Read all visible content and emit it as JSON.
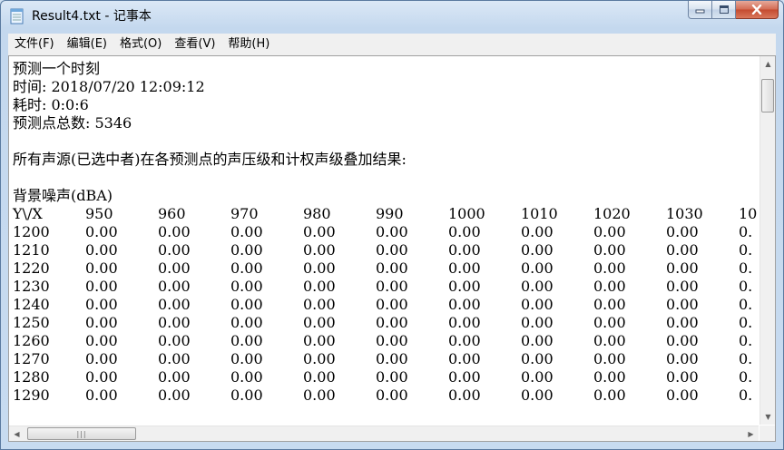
{
  "window": {
    "title": "Result4.txt - 记事本",
    "controls": {
      "minimize": "minimize",
      "maximize": "maximize",
      "close": "close"
    }
  },
  "menu": [
    {
      "label": "文件(F)"
    },
    {
      "label": "编辑(E)"
    },
    {
      "label": "格式(O)"
    },
    {
      "label": "查看(V)"
    },
    {
      "label": "帮助(H)"
    }
  ],
  "document": {
    "header_lines": [
      "预测一个时刻",
      "时间: 2018/07/20 12:09:12",
      "耗时: 0:0:6",
      "预测点总数: 5346",
      "",
      "所有声源(已选中者)在各预测点的声压级和计权声级叠加结果:",
      "",
      "背景噪声(dBA)"
    ],
    "table": {
      "corner": "Y\\/X",
      "columns": [
        "950",
        "960",
        "970",
        "980",
        "990",
        "1000",
        "1010",
        "1020",
        "1030",
        "10"
      ],
      "rows": [
        {
          "y": "1200",
          "values": [
            "0.00",
            "0.00",
            "0.00",
            "0.00",
            "0.00",
            "0.00",
            "0.00",
            "0.00",
            "0.00",
            "0."
          ]
        },
        {
          "y": "1210",
          "values": [
            "0.00",
            "0.00",
            "0.00",
            "0.00",
            "0.00",
            "0.00",
            "0.00",
            "0.00",
            "0.00",
            "0."
          ]
        },
        {
          "y": "1220",
          "values": [
            "0.00",
            "0.00",
            "0.00",
            "0.00",
            "0.00",
            "0.00",
            "0.00",
            "0.00",
            "0.00",
            "0."
          ]
        },
        {
          "y": "1230",
          "values": [
            "0.00",
            "0.00",
            "0.00",
            "0.00",
            "0.00",
            "0.00",
            "0.00",
            "0.00",
            "0.00",
            "0."
          ]
        },
        {
          "y": "1240",
          "values": [
            "0.00",
            "0.00",
            "0.00",
            "0.00",
            "0.00",
            "0.00",
            "0.00",
            "0.00",
            "0.00",
            "0."
          ]
        },
        {
          "y": "1250",
          "values": [
            "0.00",
            "0.00",
            "0.00",
            "0.00",
            "0.00",
            "0.00",
            "0.00",
            "0.00",
            "0.00",
            "0."
          ]
        },
        {
          "y": "1260",
          "values": [
            "0.00",
            "0.00",
            "0.00",
            "0.00",
            "0.00",
            "0.00",
            "0.00",
            "0.00",
            "0.00",
            "0."
          ]
        },
        {
          "y": "1270",
          "values": [
            "0.00",
            "0.00",
            "0.00",
            "0.00",
            "0.00",
            "0.00",
            "0.00",
            "0.00",
            "0.00",
            "0."
          ]
        },
        {
          "y": "1280",
          "values": [
            "0.00",
            "0.00",
            "0.00",
            "0.00",
            "0.00",
            "0.00",
            "0.00",
            "0.00",
            "0.00",
            "0."
          ]
        },
        {
          "y": "1290",
          "values": [
            "0.00",
            "0.00",
            "0.00",
            "0.00",
            "0.00",
            "0.00",
            "0.00",
            "0.00",
            "0.00",
            "0."
          ]
        }
      ]
    }
  },
  "scrollbars": {
    "up_arrow": "▲",
    "down_arrow": "▼",
    "left_arrow": "◀",
    "right_arrow": "▶",
    "grip": "|||"
  }
}
